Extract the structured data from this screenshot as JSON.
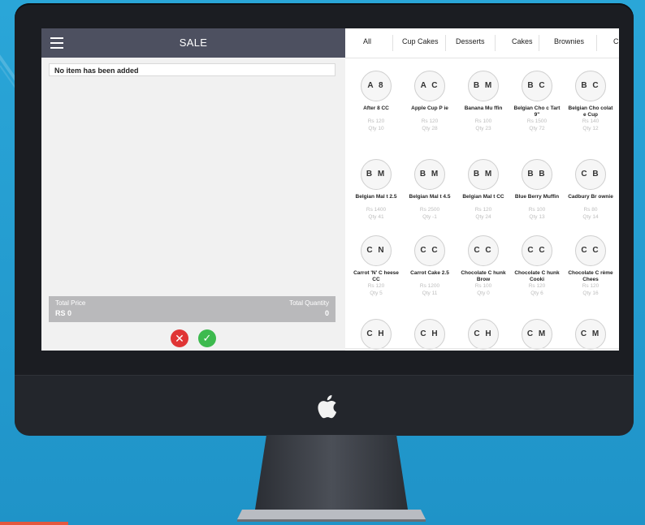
{
  "header": {
    "title": "SALE"
  },
  "cart": {
    "empty_message": "No item has been added"
  },
  "totals": {
    "price_label": "Total Price",
    "price_value": "RS 0",
    "qty_label": "Total Quantity",
    "qty_value": "0"
  },
  "actions": {
    "cancel_icon": "close-icon",
    "confirm_icon": "check-icon",
    "cancel_color": "#e03535",
    "confirm_color": "#3dba4e"
  },
  "tabs": [
    "All",
    "Cup Cakes",
    "Desserts",
    "Cakes",
    "Brownies",
    "C"
  ],
  "items": [
    {
      "initials": "A 8",
      "name": "After 8 CC",
      "price": "Rs 120",
      "qty": "Qty 10"
    },
    {
      "initials": "A C",
      "name": "Apple Cup P ie",
      "price": "Rs 120",
      "qty": "Qty 28"
    },
    {
      "initials": "B M",
      "name": "Banana Mu ffin",
      "price": "Rs 100",
      "qty": "Qty 23"
    },
    {
      "initials": "B C",
      "name": "Belgian Cho c Tart 9\"",
      "price": "Rs 1500",
      "qty": "Qty 72"
    },
    {
      "initials": "B C",
      "name": "Belgian Cho colate Cup",
      "price": "Rs 140",
      "qty": "Qty 12"
    },
    {
      "initials": "B M",
      "name": "Belgian Mal t 2.5",
      "price": "Rs 1400",
      "qty": "Qty 41"
    },
    {
      "initials": "B M",
      "name": "Belgian Mal t 4.5",
      "price": "Rs 2500",
      "qty": "Qty -1"
    },
    {
      "initials": "B M",
      "name": "Belgian Mal t CC",
      "price": "Rs 120",
      "qty": "Qty 24"
    },
    {
      "initials": "B B",
      "name": "Blue Berry Muffin",
      "price": "Rs 100",
      "qty": "Qty 13"
    },
    {
      "initials": "C B",
      "name": "Cadbury Br ownie",
      "price": "Rs 80",
      "qty": "Qty 14"
    },
    {
      "initials": "C N",
      "name": "Carrot 'N' C heese CC",
      "price": "Rs 120",
      "qty": "Qty 5"
    },
    {
      "initials": "C C",
      "name": "Carrot Cake 2.5",
      "price": "Rs 1200",
      "qty": "Qty 11"
    },
    {
      "initials": "C C",
      "name": "Chocolate C hunk Brow",
      "price": "Rs 100",
      "qty": "Qty 0"
    },
    {
      "initials": "C C",
      "name": "Chocolate C hunk Cooki",
      "price": "Rs 120",
      "qty": "Qty 6"
    },
    {
      "initials": "C C",
      "name": "Chocolate C rème Chees",
      "price": "Rs 120",
      "qty": "Qty 16"
    },
    {
      "initials": "C H",
      "name": "",
      "price": "",
      "qty": ""
    },
    {
      "initials": "C H",
      "name": "",
      "price": "",
      "qty": ""
    },
    {
      "initials": "C H",
      "name": "",
      "price": "",
      "qty": ""
    },
    {
      "initials": "C M",
      "name": "",
      "price": "",
      "qty": ""
    },
    {
      "initials": "C M",
      "name": "",
      "price": "",
      "qty": ""
    }
  ]
}
